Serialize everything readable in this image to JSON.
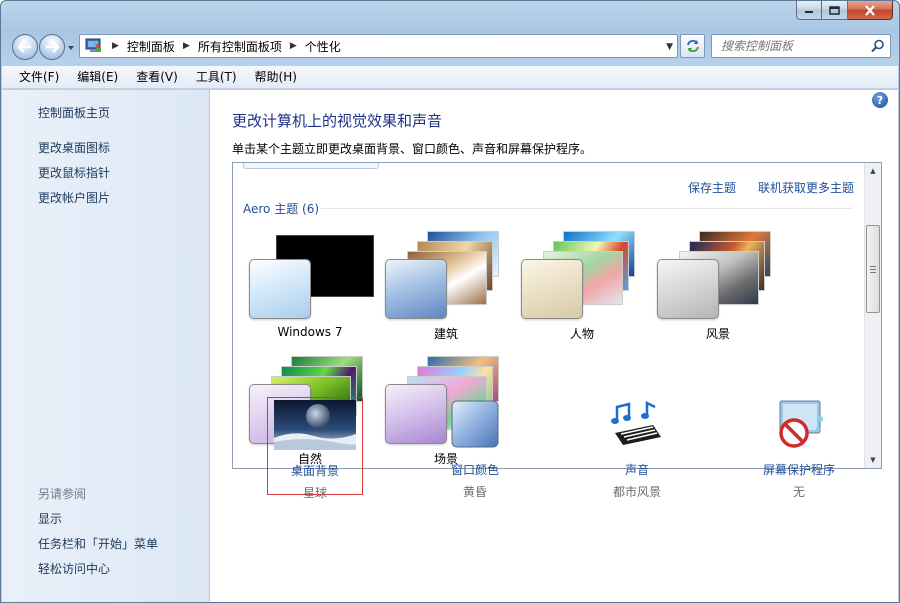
{
  "window": {
    "caption_buttons": [
      "minimize-icon",
      "maximize-icon",
      "close-icon"
    ]
  },
  "address_bar": {
    "breadcrumbs": [
      "控制面板",
      "所有控制面板项",
      "个性化"
    ],
    "search_placeholder": "搜索控制面板"
  },
  "menu": {
    "items": [
      "文件(F)",
      "编辑(E)",
      "查看(V)",
      "工具(T)",
      "帮助(H)"
    ]
  },
  "sidebar": {
    "home": "控制面板主页",
    "tasks": [
      "更改桌面图标",
      "更改鼠标指针",
      "更改帐户图片"
    ],
    "see_also_title": "另请参阅",
    "see_also": [
      "显示",
      "任务栏和「开始」菜单",
      "轻松访问中心"
    ]
  },
  "main": {
    "help": "?",
    "title": "更改计算机上的视觉效果和声音",
    "subtitle": "单击某个主题立即更改桌面背景、窗口颜色、声音和屏幕保护程序。",
    "save_theme": "保存主题",
    "get_more_themes": "联机获取更多主题",
    "aero_group": "Aero 主题 (6)",
    "themes": [
      {
        "name": "Windows 7"
      },
      {
        "name": "建筑"
      },
      {
        "name": "人物"
      },
      {
        "name": "风景"
      },
      {
        "name": "自然"
      },
      {
        "name": "场景"
      }
    ]
  },
  "bottom": {
    "desktop_background": {
      "label": "桌面背景",
      "value": "星球"
    },
    "window_color": {
      "label": "窗口颜色",
      "value": "黄昏"
    },
    "sounds": {
      "label": "声音",
      "value": "都市风景"
    },
    "screensaver": {
      "label": "屏幕保护程序",
      "value": "无"
    }
  },
  "colors": {
    "link": "#1e4e9a",
    "title": "#1e3287",
    "selected_border": "#d33a3a"
  }
}
